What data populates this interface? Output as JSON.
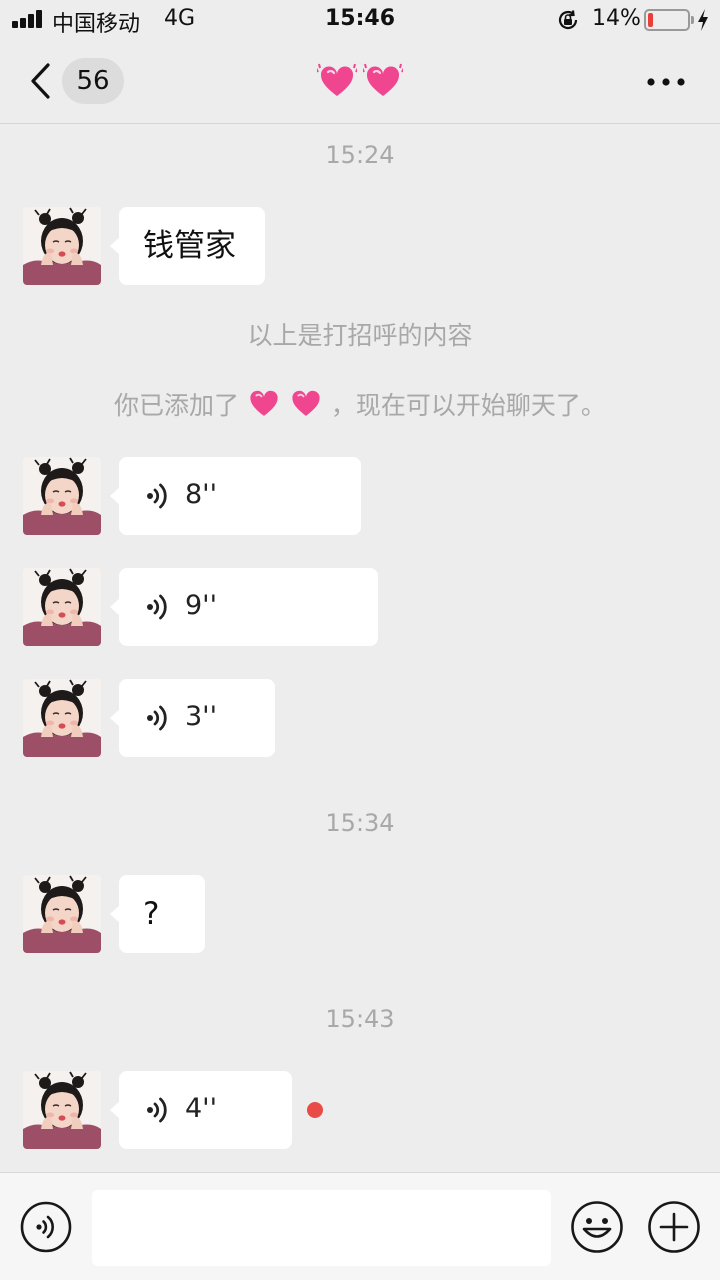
{
  "status_bar": {
    "carrier": "中国移动",
    "network": "4G",
    "time": "15:46",
    "battery_percent": "14%",
    "battery_level": 0.14,
    "icons": [
      "signal-icon",
      "orientation-lock-icon",
      "battery-icon",
      "charging-icon"
    ]
  },
  "nav": {
    "unread_count": "56",
    "title_icons": [
      "beating-heart-emoji",
      "beating-heart-emoji"
    ],
    "icons": [
      "back-chevron-icon",
      "more-dots-icon"
    ]
  },
  "messages": {
    "time_1": "15:24",
    "greeting_text": "钱管家",
    "system_greeting": "以上是打招呼的内容",
    "system_added_prefix": "你已添加了",
    "system_added_suffix": "，现在可以开始聊天了。",
    "voice_1": "8''",
    "voice_2": "9''",
    "voice_3": "3''",
    "time_2": "15:34",
    "question_text": "?",
    "time_3": "15:43",
    "voice_4": "4''"
  },
  "input_bar": {
    "value": "",
    "icons": [
      "voice-mode-icon",
      "emoji-icon",
      "plus-icon"
    ]
  },
  "colors": {
    "background": "#ededed",
    "bubble": "#ffffff",
    "unread_dot": "#e94b47",
    "heart": "#f0458f",
    "battery_low": "#e93f3b"
  }
}
